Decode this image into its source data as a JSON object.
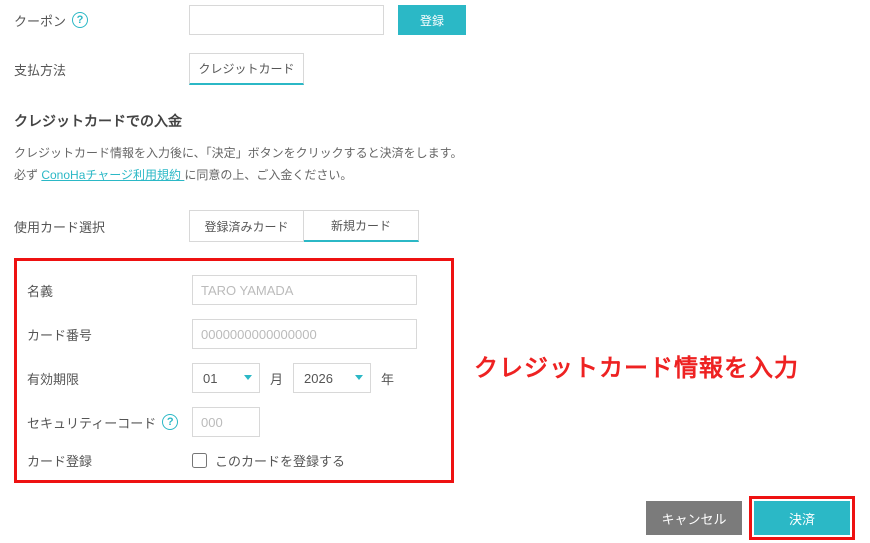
{
  "coupon": {
    "label": "クーポン",
    "register_btn": "登録"
  },
  "payment_method": {
    "label": "支払方法",
    "tab_credit": "クレジットカード"
  },
  "section_title": "クレジットカードでの入金",
  "desc_line1": "クレジットカード情報を入力後に、「決定」ボタンをクリックすると決済をします。",
  "desc_prefix": "必ず ",
  "desc_link": "ConoHaチャージ利用規約 ",
  "desc_suffix": "に同意の上、ご入金ください。",
  "card_select": {
    "label": "使用カード選択",
    "tab_registered": "登録済みカード",
    "tab_new": "新規カード"
  },
  "form": {
    "name_label": "名義",
    "name_placeholder": "TARO YAMADA",
    "number_label": "カード番号",
    "number_placeholder": "0000000000000000",
    "expiry_label": "有効期限",
    "month_value": "01",
    "month_unit": "月",
    "year_value": "2026",
    "year_unit": "年",
    "cvv_label": "セキュリティーコード",
    "cvv_placeholder": "000",
    "register_card_label": "カード登録",
    "register_card_checkbox": "このカードを登録する"
  },
  "annotation": "クレジットカード情報を入力",
  "actions": {
    "cancel": "キャンセル",
    "submit": "決済"
  }
}
